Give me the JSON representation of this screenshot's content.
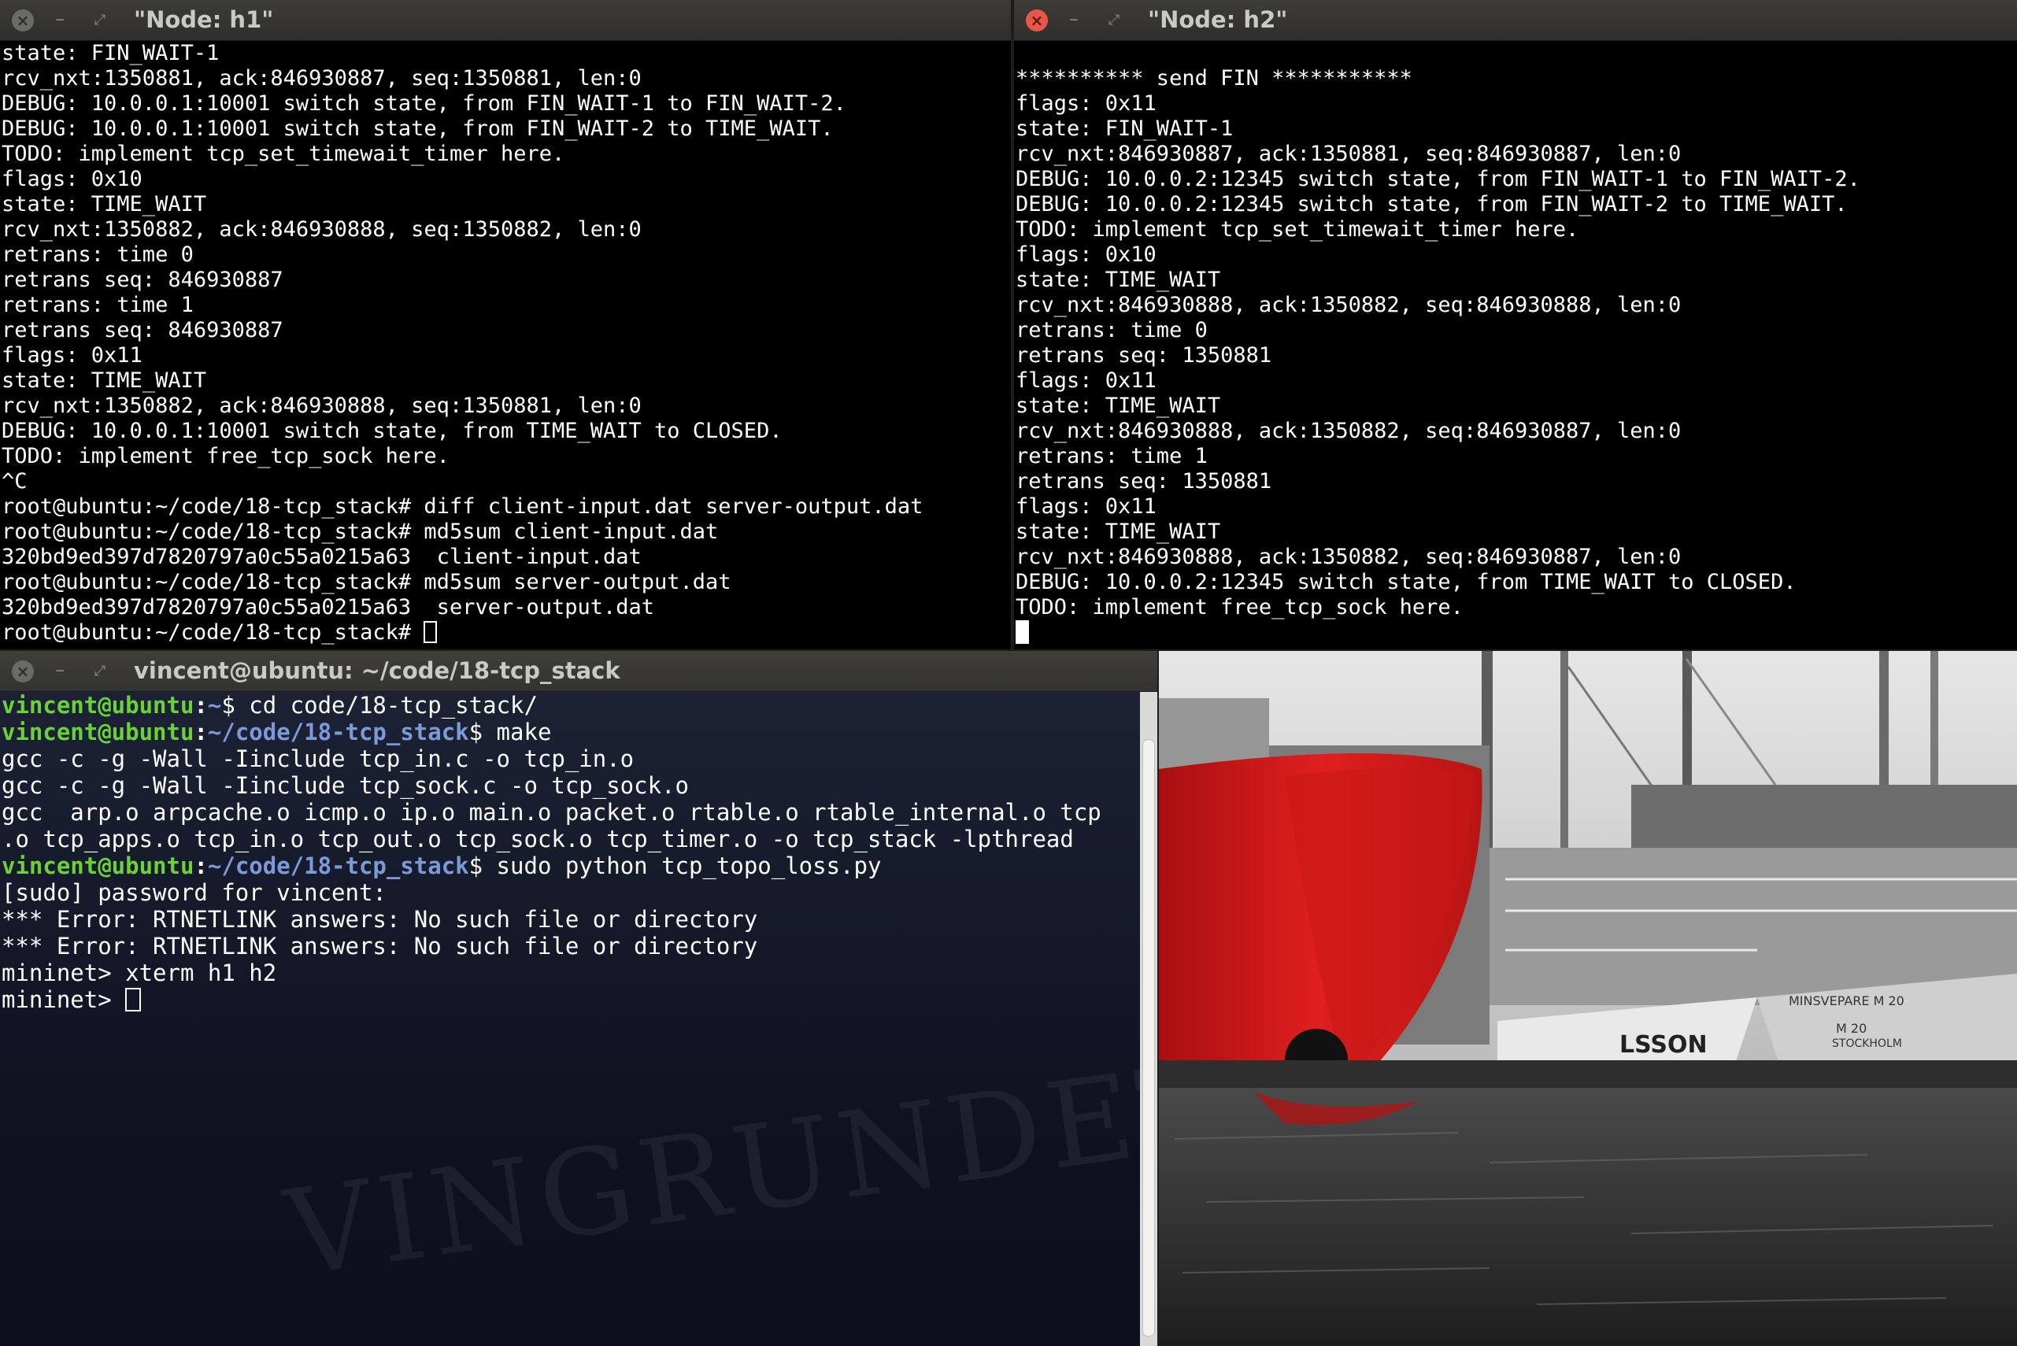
{
  "h1": {
    "title": "\"Node: h1\"",
    "lines": [
      "state: FIN_WAIT-1",
      "rcv_nxt:1350881, ack:846930887, seq:1350881, len:0",
      "DEBUG: 10.0.0.1:10001 switch state, from FIN_WAIT-1 to FIN_WAIT-2.",
      "DEBUG: 10.0.0.1:10001 switch state, from FIN_WAIT-2 to TIME_WAIT.",
      "TODO: implement tcp_set_timewait_timer here.",
      "flags: 0x10",
      "state: TIME_WAIT",
      "rcv_nxt:1350882, ack:846930888, seq:1350882, len:0",
      "retrans: time 0",
      "retrans seq: 846930887",
      "retrans: time 1",
      "retrans seq: 846930887",
      "flags: 0x11",
      "state: TIME_WAIT",
      "rcv_nxt:1350882, ack:846930888, seq:1350881, len:0",
      "DEBUG: 10.0.0.1:10001 switch state, from TIME_WAIT to CLOSED.",
      "TODO: implement free_tcp_sock here.",
      "^C",
      "root@ubuntu:~/code/18-tcp_stack# diff client-input.dat server-output.dat",
      "root@ubuntu:~/code/18-tcp_stack# md5sum client-input.dat",
      "320bd9ed397d7820797a0c55a0215a63  client-input.dat",
      "root@ubuntu:~/code/18-tcp_stack# md5sum server-output.dat",
      "320bd9ed397d7820797a0c55a0215a63  server-output.dat"
    ],
    "prompt": "root@ubuntu:~/code/18-tcp_stack# "
  },
  "h2": {
    "title": "\"Node: h2\"",
    "lines": [
      "",
      "********** send FIN ***********",
      "flags: 0x11",
      "state: FIN_WAIT-1",
      "rcv_nxt:846930887, ack:1350881, seq:846930887, len:0",
      "DEBUG: 10.0.0.2:12345 switch state, from FIN_WAIT-1 to FIN_WAIT-2.",
      "DEBUG: 10.0.0.2:12345 switch state, from FIN_WAIT-2 to TIME_WAIT.",
      "TODO: implement tcp_set_timewait_timer here.",
      "flags: 0x10",
      "state: TIME_WAIT",
      "rcv_nxt:846930888, ack:1350882, seq:846930888, len:0",
      "retrans: time 0",
      "retrans seq: 1350881",
      "flags: 0x11",
      "state: TIME_WAIT",
      "rcv_nxt:846930888, ack:1350882, seq:846930887, len:0",
      "retrans: time 1",
      "retrans seq: 1350881",
      "flags: 0x11",
      "state: TIME_WAIT",
      "rcv_nxt:846930888, ack:1350882, seq:846930887, len:0",
      "DEBUG: 10.0.0.2:12345 switch state, from TIME_WAIT to CLOSED.",
      "TODO: implement free_tcp_sock here."
    ]
  },
  "terminal": {
    "title": "vincent@ubuntu: ~/code/18-tcp_stack",
    "user_host": "vincent@ubuntu",
    "cmd1": {
      "path": "~",
      "command": "$ cd code/18-tcp_stack/"
    },
    "cmd2": {
      "path": "~/code/18-tcp_stack",
      "command": "$ make"
    },
    "make_output": [
      "gcc -c -g -Wall -Iinclude tcp_in.c -o tcp_in.o",
      "gcc -c -g -Wall -Iinclude tcp_sock.c -o tcp_sock.o",
      "gcc  arp.o arpcache.o icmp.o ip.o main.o packet.o rtable.o rtable_internal.o tcp",
      ".o tcp_apps.o tcp_in.o tcp_out.o tcp_sock.o tcp_timer.o -o tcp_stack -lpthread"
    ],
    "cmd3": {
      "path": "~/code/18-tcp_stack",
      "command": "$ sudo python tcp_topo_loss.py"
    },
    "run_output": [
      "[sudo] password for vincent:",
      "*** Error: RTNETLINK answers: No such file or directory",
      "*** Error: RTNETLINK answers: No such file or directory",
      "mininet> xterm h1 h2"
    ],
    "mininet_prompt": "mininet> ",
    "bg_watermark": "VINGRUNDET"
  },
  "window_buttons": {
    "close": "×",
    "minimize": "–",
    "maximize": "⤢"
  },
  "wallpaper": {
    "ship_name": "LSSON",
    "boat_name": "MINSVEPARE M 20",
    "boat_number": "M 20",
    "boat_home": "STOCKHOLM"
  },
  "colors": {
    "accent_close": "#e8564a",
    "prompt_user": "#6ad13a",
    "prompt_path": "#7a9ad9",
    "ship_red": "#d81e1e"
  }
}
